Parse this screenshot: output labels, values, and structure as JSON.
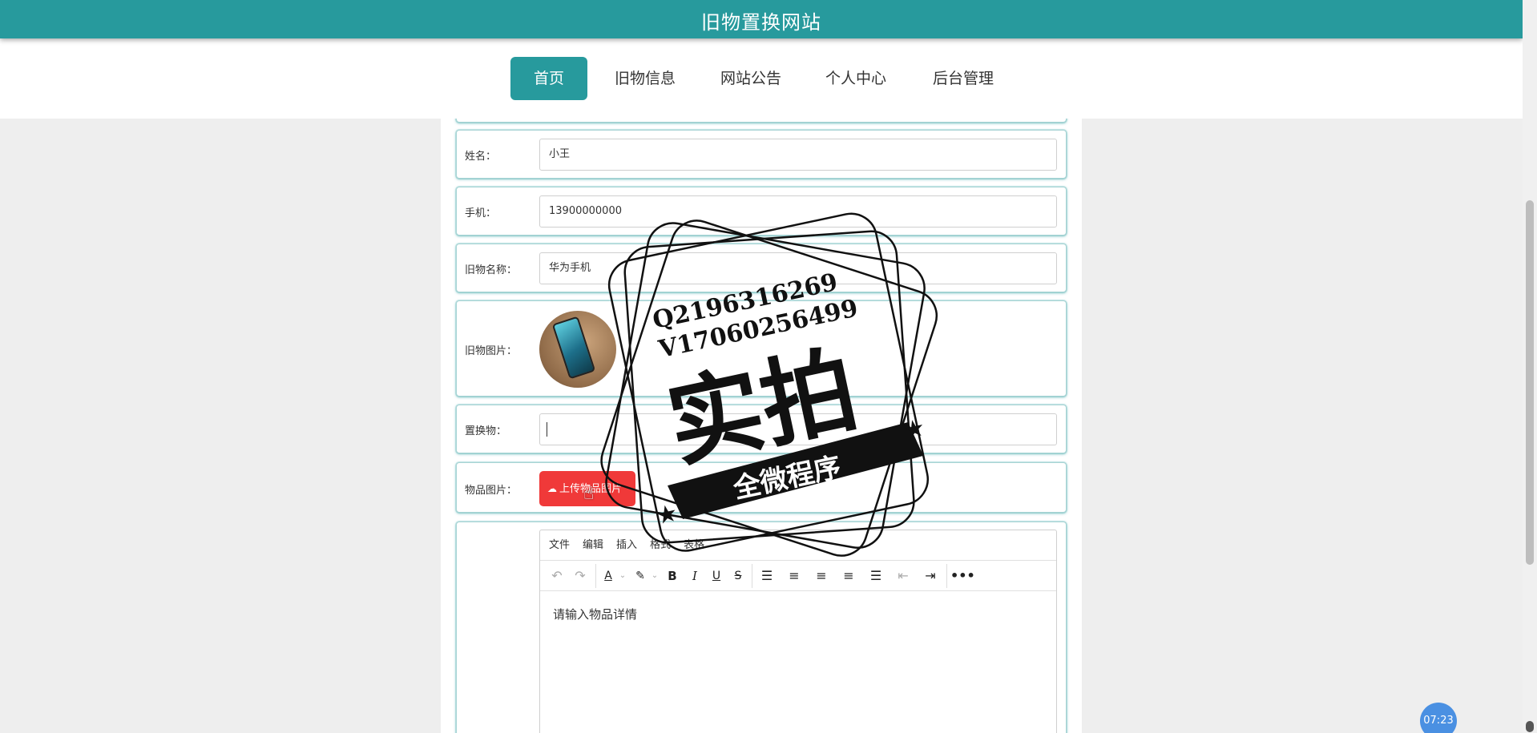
{
  "header": {
    "site_title": "旧物置换网站"
  },
  "nav": {
    "items": [
      {
        "label": "首页",
        "active": true
      },
      {
        "label": "旧物信息",
        "active": false
      },
      {
        "label": "网站公告",
        "active": false
      },
      {
        "label": "个人中心",
        "active": false
      },
      {
        "label": "后台管理",
        "active": false
      }
    ]
  },
  "form": {
    "name": {
      "label": "姓名：",
      "value": "小王"
    },
    "phone": {
      "label": "手机：",
      "value": "13900000000"
    },
    "item_name": {
      "label": "旧物名称：",
      "value": "华为手机"
    },
    "item_image": {
      "label": "旧物图片："
    },
    "exchange_item": {
      "label": "置换物：",
      "value": ""
    },
    "goods_image": {
      "label": "物品图片：",
      "upload_label": "上传物品图片"
    }
  },
  "editor": {
    "menus": [
      "文件",
      "编辑",
      "插入",
      "格式",
      "表格"
    ],
    "placeholder": "请输入物品详情",
    "toolbar_icons": [
      "undo-icon",
      "redo-icon",
      "text-color-icon",
      "highlight-icon",
      "bold-icon",
      "italic-icon",
      "underline-icon",
      "strikethrough-icon",
      "line-height-icon",
      "align-left-icon",
      "align-center-icon",
      "align-right-icon",
      "align-justify-icon",
      "outdent-icon",
      "indent-icon",
      "more-icon"
    ]
  },
  "watermark": {
    "line1": "Q2196316269",
    "line2": "V17060256499",
    "main_text": "实拍",
    "ribbon_text": "全微程序"
  },
  "timer": {
    "text": "07:23"
  },
  "colors": {
    "primary": "#279a9d",
    "upload_button": "#f03939",
    "timer": "#4a90e2"
  }
}
